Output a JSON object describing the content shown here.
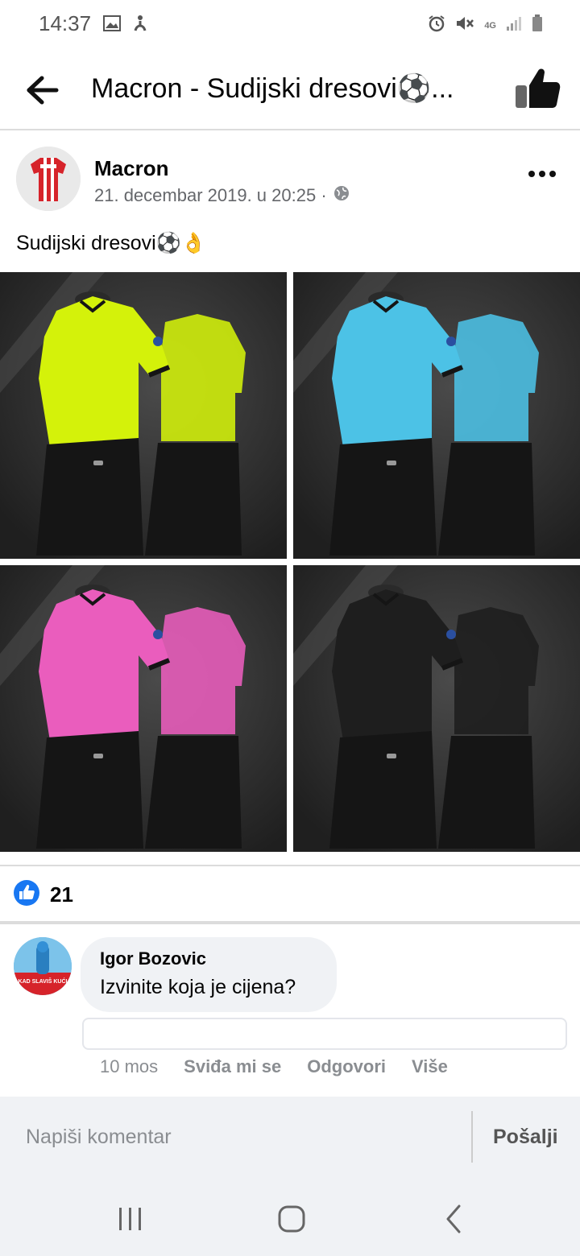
{
  "status_bar": {
    "time": "14:37",
    "network": "4G",
    "icons": [
      "image-icon",
      "accessibility-icon",
      "alarm-icon",
      "mute-icon",
      "signal-icon",
      "battery-icon"
    ]
  },
  "header": {
    "title": "Macron - Sudijski dresovi⚽...",
    "icons": [
      "back-arrow-icon",
      "thumbs-up-icon"
    ]
  },
  "post": {
    "author": "Macron",
    "date": "21. decembar 2019. u 20:25 ·",
    "text": "Sudijski dresovi⚽👌",
    "photos": [
      {
        "name": "yellow-referee-kit",
        "shirt_color": "#d4f20a"
      },
      {
        "name": "blue-referee-kit",
        "shirt_color": "#4cc2e6"
      },
      {
        "name": "pink-referee-kit",
        "shirt_color": "#ea5dbd"
      },
      {
        "name": "black-referee-kit",
        "shirt_color": "#1e1e1e"
      }
    ],
    "likes": "21"
  },
  "comment": {
    "author": "Igor Bozovic",
    "text": "Izvinite koja je cijena?",
    "time": "10 mos",
    "actions": [
      "Sviđa mi se",
      "Odgovori",
      "Više"
    ],
    "avatar_caption": "KAD SLAVIŠ KUĆI"
  },
  "composer": {
    "placeholder": "Napiši komentar",
    "send_label": "Pošalji"
  },
  "colors": {
    "facebook_blue": "#1877f2",
    "secondary_text": "#65676b"
  }
}
